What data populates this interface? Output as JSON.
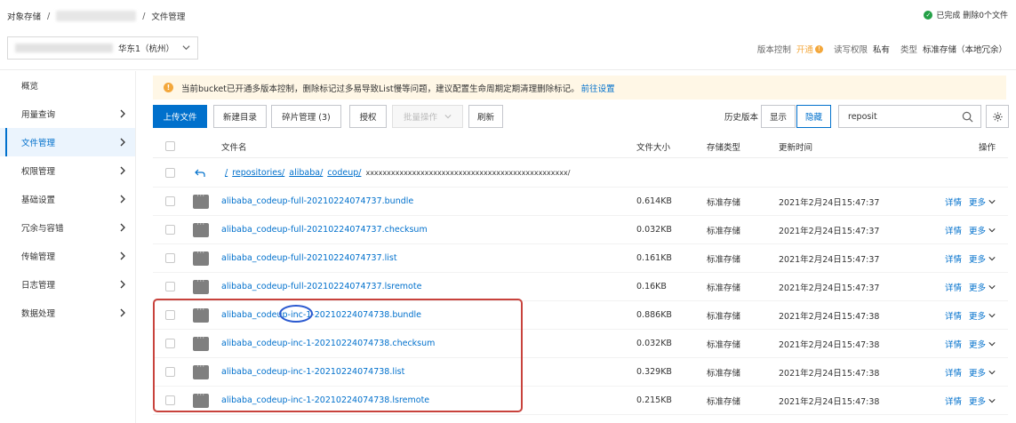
{
  "breadcrumb": {
    "root": "对象存储",
    "separator": "/",
    "current": "文件管理"
  },
  "top_status": {
    "icon": "check-circle-icon",
    "text": "已完成 删除0个文件"
  },
  "region_select": {
    "value": "华东1（杭州）"
  },
  "bucket_meta": {
    "version_label": "版本控制",
    "version_value": "开通",
    "rw_label": "读写权限",
    "rw_value": "私有",
    "type_label": "类型",
    "type_value": "标准存储（本地冗余）",
    "warn_color": "#f3a73b"
  },
  "sidebar": {
    "items": [
      {
        "label": "概览",
        "chevron": false,
        "active": false
      },
      {
        "label": "用量查询",
        "chevron": true,
        "active": false
      },
      {
        "label": "文件管理",
        "chevron": true,
        "active": true
      },
      {
        "label": "权限管理",
        "chevron": true,
        "active": false
      },
      {
        "label": "基础设置",
        "chevron": true,
        "active": false
      },
      {
        "label": "冗余与容错",
        "chevron": true,
        "active": false
      },
      {
        "label": "传输管理",
        "chevron": true,
        "active": false
      },
      {
        "label": "日志管理",
        "chevron": true,
        "active": false
      },
      {
        "label": "数据处理",
        "chevron": true,
        "active": false
      }
    ]
  },
  "banner": {
    "text": "当前bucket已开通多版本控制，删除标记过多易导致List慢等问题，建议配置生命周期定期清理删除标记。",
    "link": "前往设置"
  },
  "toolbar": {
    "upload": "上传文件",
    "new_dir": "新建目录",
    "fragments": "碎片管理 (3)",
    "authorize": "授权",
    "batch": "批量操作",
    "refresh": "刷新",
    "history_label": "历史版本",
    "show": "显示",
    "hide": "隐藏",
    "search_value": "reposit"
  },
  "table": {
    "headers": {
      "name": "文件名",
      "size": "文件大小",
      "storage": "存储类型",
      "updated": "更新时间",
      "ops": "操作"
    },
    "path_row": {
      "root": "/",
      "segments": [
        "repositories/",
        "alibaba/",
        "codeup/"
      ],
      "rest": "xxxxxxxxxxxxxxxxxxxxxxxxxxxxxxxxxxxxxxxxxxxxxxxx/"
    },
    "rows": [
      {
        "name": "alibaba_codeup-full-20210224074737.bundle",
        "size": "0.614KB",
        "storage": "标准存储",
        "updated": "2021年2月24日15:47:37"
      },
      {
        "name": "alibaba_codeup-full-20210224074737.checksum",
        "size": "0.032KB",
        "storage": "标准存储",
        "updated": "2021年2月24日15:47:37"
      },
      {
        "name": "alibaba_codeup-full-20210224074737.list",
        "size": "0.161KB",
        "storage": "标准存储",
        "updated": "2021年2月24日15:47:37"
      },
      {
        "name": "alibaba_codeup-full-20210224074737.lsremote",
        "size": "0.16KB",
        "storage": "标准存储",
        "updated": "2021年2月24日15:47:37"
      },
      {
        "name": "alibaba_codeup-inc-1-20210224074738.bundle",
        "size": "0.886KB",
        "storage": "标准存储",
        "updated": "2021年2月24日15:47:38"
      },
      {
        "name": "alibaba_codeup-inc-1-20210224074738.checksum",
        "size": "0.032KB",
        "storage": "标准存储",
        "updated": "2021年2月24日15:47:38"
      },
      {
        "name": "alibaba_codeup-inc-1-20210224074738.list",
        "size": "0.329KB",
        "storage": "标准存储",
        "updated": "2021年2月24日15:47:38"
      },
      {
        "name": "alibaba_codeup-inc-1-20210224074738.lsremote",
        "size": "0.215KB",
        "storage": "标准存储",
        "updated": "2021年2月24日15:47:38"
      }
    ],
    "op_detail": "详情",
    "op_more": "更多"
  },
  "colors": {
    "link": "#0070cc",
    "annotation_box": "#c8423c",
    "annotation_oval": "#2b5ad0"
  }
}
